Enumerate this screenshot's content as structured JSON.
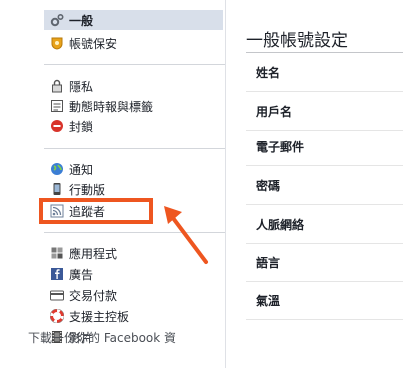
{
  "sidebar": {
    "group1": [
      {
        "label": "一般",
        "icon": "gear-icon",
        "selected": true
      },
      {
        "label": "帳號保安",
        "icon": "shield-badge-icon"
      }
    ],
    "group2": [
      {
        "label": "隱私",
        "icon": "padlock-icon"
      },
      {
        "label": "動態時報與標籤",
        "icon": "timeline-icon"
      },
      {
        "label": "封鎖",
        "icon": "block-icon"
      }
    ],
    "group3": [
      {
        "label": "通知",
        "icon": "globe-icon"
      },
      {
        "label": "行動版",
        "icon": "mobile-phone-icon"
      },
      {
        "label": "追蹤者",
        "icon": "rss-feed-icon"
      }
    ],
    "group4": [
      {
        "label": "應用程式",
        "icon": "apps-cube-icon"
      },
      {
        "label": "廣告",
        "icon": "ads-icon"
      },
      {
        "label": "交易付款",
        "icon": "credit-card-icon"
      },
      {
        "label": "支援主控板",
        "icon": "lifebuoy-icon"
      },
      {
        "label": "影片",
        "icon": "film-strip-icon"
      }
    ]
  },
  "main": {
    "title": "一般帳號設定",
    "rows": [
      {
        "label": "姓名"
      },
      {
        "label": "用戶名"
      },
      {
        "label": "電子郵件"
      },
      {
        "label": "密碼"
      },
      {
        "label": "人脈網絡"
      },
      {
        "label": "語言"
      },
      {
        "label": "氣溫"
      }
    ],
    "footer": "下載一份你的 Facebook 資"
  },
  "annotation": {
    "highlight_color": "#ee5620"
  }
}
